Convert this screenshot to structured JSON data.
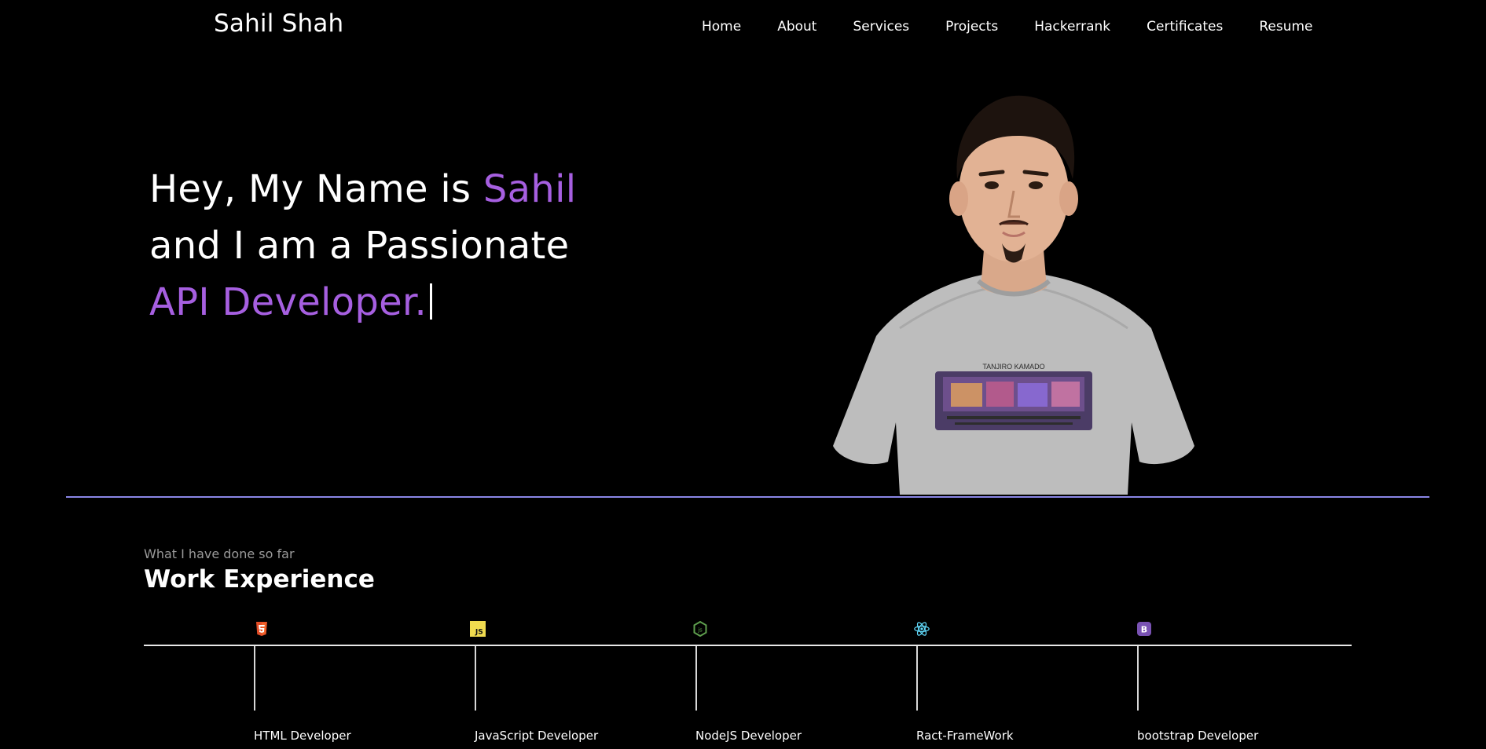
{
  "brand": {
    "name": "Sahil Shah"
  },
  "nav": {
    "items": [
      "Home",
      "About",
      "Services",
      "Projects",
      "Hackerrank",
      "Certificates",
      "Resume"
    ]
  },
  "hero": {
    "line1_prefix": "Hey, My Name is ",
    "line1_name": "Sahil",
    "line2": "and I am a Passionate",
    "line3_role": "API Developer.",
    "accent_color": "#a65fe0",
    "portrait_shirt_text": "TANJIRO KAMADO"
  },
  "work": {
    "kicker": "What I have done so far",
    "title": "Work Experience",
    "items": [
      {
        "label": "HTML Developer",
        "icon": "html5-icon"
      },
      {
        "label": "JavaScript Developer",
        "icon": "javascript-icon"
      },
      {
        "label": "NodeJS Developer",
        "icon": "nodejs-icon"
      },
      {
        "label": "Ract-FrameWork",
        "icon": "react-icon"
      },
      {
        "label": "bootstrap Developer",
        "icon": "bootstrap-icon"
      }
    ]
  },
  "colors": {
    "background": "#000000",
    "accent": "#a65fe0",
    "divider": "#8a86e6"
  }
}
